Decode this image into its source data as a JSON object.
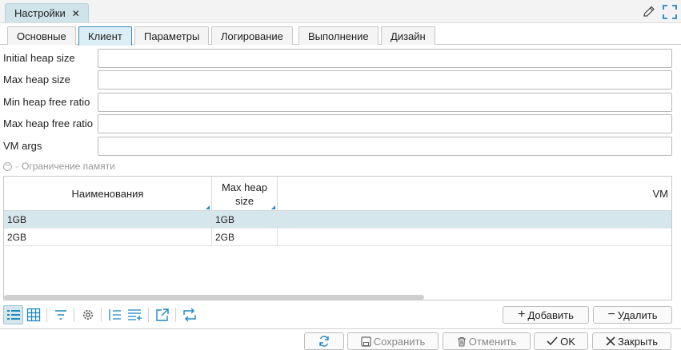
{
  "doc_tab": {
    "title": "Настройки",
    "close": "✕"
  },
  "tabs": [
    "Основные",
    "Клиент",
    "Параметры",
    "Логирование",
    "Выполнение",
    "Дизайн"
  ],
  "active_tab": "Клиент",
  "fields": [
    {
      "label": "Initial heap size",
      "value": ""
    },
    {
      "label": "Max heap size",
      "value": ""
    },
    {
      "label": "Min heap free ratio",
      "value": ""
    },
    {
      "label": "Max heap free ratio",
      "value": ""
    },
    {
      "label": "VM args",
      "value": ""
    }
  ],
  "group": {
    "title": "Ограничение памяти"
  },
  "table": {
    "columns": [
      "Наименования",
      "Max heap\nsize",
      "VM"
    ],
    "rows": [
      {
        "name": "1GB",
        "max_heap": "1GB",
        "selected": true
      },
      {
        "name": "2GB",
        "max_heap": "2GB",
        "selected": false
      }
    ]
  },
  "toolbar": {
    "add_label": "Добавить",
    "delete_label": "Удалить",
    "add_icon": "plus-icon",
    "delete_icon": "minus-icon"
  },
  "footer": {
    "refresh_icon": "refresh-icon",
    "save_label": "Сохранить",
    "cancel_label": "Отменить",
    "ok_label": "OK",
    "close_label": "Закрыть"
  },
  "colors": {
    "accent": "#1c88c8",
    "selected_row": "#d5e6ec",
    "active_tab": "#dceef5"
  }
}
